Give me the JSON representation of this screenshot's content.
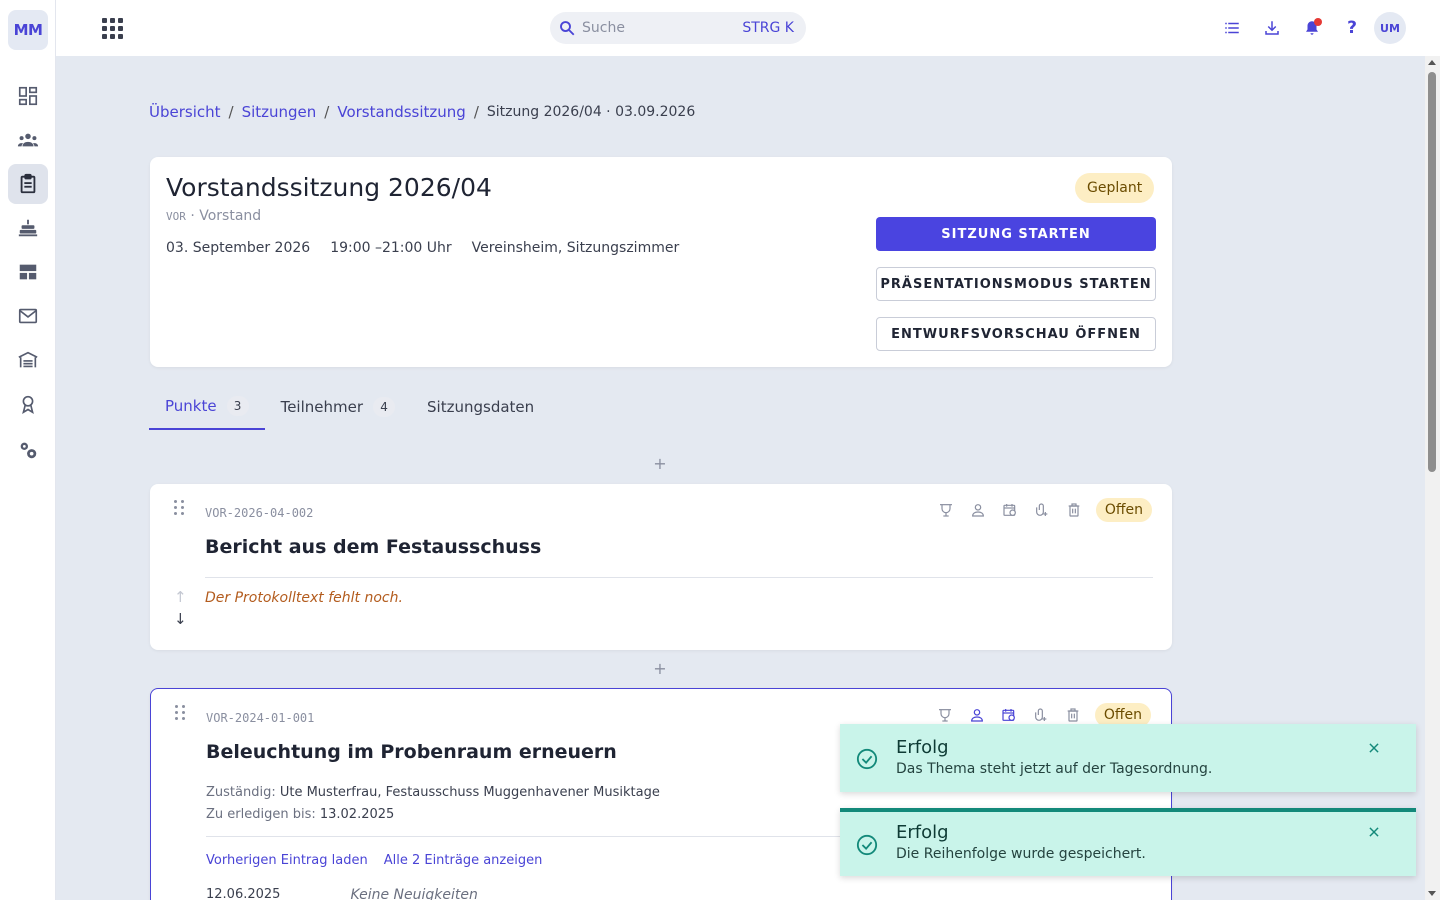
{
  "sidebar": {
    "logo": "MM",
    "items": [
      {
        "name": "dashboard",
        "icon": "dashboard-icon"
      },
      {
        "name": "members",
        "icon": "people-icon"
      },
      {
        "name": "meetings",
        "icon": "clipboard-icon",
        "active": true
      },
      {
        "name": "events",
        "icon": "cake-icon"
      },
      {
        "name": "tables",
        "icon": "table-icon"
      },
      {
        "name": "mail",
        "icon": "mail-icon"
      },
      {
        "name": "organization",
        "icon": "warehouse-icon"
      },
      {
        "name": "awards",
        "icon": "medal-icon"
      },
      {
        "name": "settings",
        "icon": "gears-icon"
      }
    ]
  },
  "topbar": {
    "search_placeholder": "Suche",
    "search_shortcut": "STRG K",
    "avatar": "UM",
    "icons": [
      "list-icon",
      "download-icon",
      "bell-icon",
      "help-icon"
    ],
    "help_glyph": "?"
  },
  "breadcrumb": {
    "items": [
      "Übersicht",
      "Sitzungen",
      "Vorstandssitzung"
    ],
    "separator": "/",
    "current": "Sitzung 2026/04 · 03.09.2026"
  },
  "meeting": {
    "title": "Vorstandssitzung 2026/04",
    "code": "VOR",
    "group": " · Vorstand",
    "date": "03. September 2026",
    "time": "19:00 –21:00 Uhr",
    "location": "Vereinsheim, Sitzungszimmer",
    "status": "Geplant",
    "status_color": "#fdeec4",
    "start_label": "SITZUNG STARTEN",
    "present_label": "PRÄSENTATIONSMODUS STARTEN",
    "preview_label": "ENTWURFSVORSCHAU ÖFFNEN",
    "accent": "#4a44e0"
  },
  "tabs": [
    {
      "label": "Punkte",
      "count": "3",
      "active": true
    },
    {
      "label": "Teilnehmer",
      "count": "4"
    },
    {
      "label": "Sitzungsdaten"
    }
  ],
  "add_glyph": "+",
  "agenda": [
    {
      "code": "VOR-2026-04-002",
      "title": "Bericht aus dem Festausschuss",
      "status": "Offen",
      "missing_protocol": "Der Protokolltext fehlt noch.",
      "arrow_up": "↑",
      "arrow_down": "↓"
    },
    {
      "code": "VOR-2024-01-001",
      "title": "Beleuchtung im Probenraum erneuern",
      "status": "Offen",
      "responsible_label": "Zuständig:",
      "responsible": " Ute Musterfrau, Festausschuss Muggenhavener Musiktage",
      "due_label": "Zu erledigen bis:",
      "due": " 13.02.2025",
      "link_prev": "Vorherigen Eintrag laden",
      "link_all": "Alle 2 Einträge anzeigen",
      "entry_date": "12.06.2025",
      "entry_note": "Keine Neuigkeiten"
    }
  ],
  "toasts": [
    {
      "title": "Erfolg",
      "message": "Das Thema steht jetzt auf der Tagesordnung."
    },
    {
      "title": "Erfolg",
      "message": "Die Reihenfolge wurde gespeichert."
    }
  ],
  "toast_color": "#c9f4ea"
}
